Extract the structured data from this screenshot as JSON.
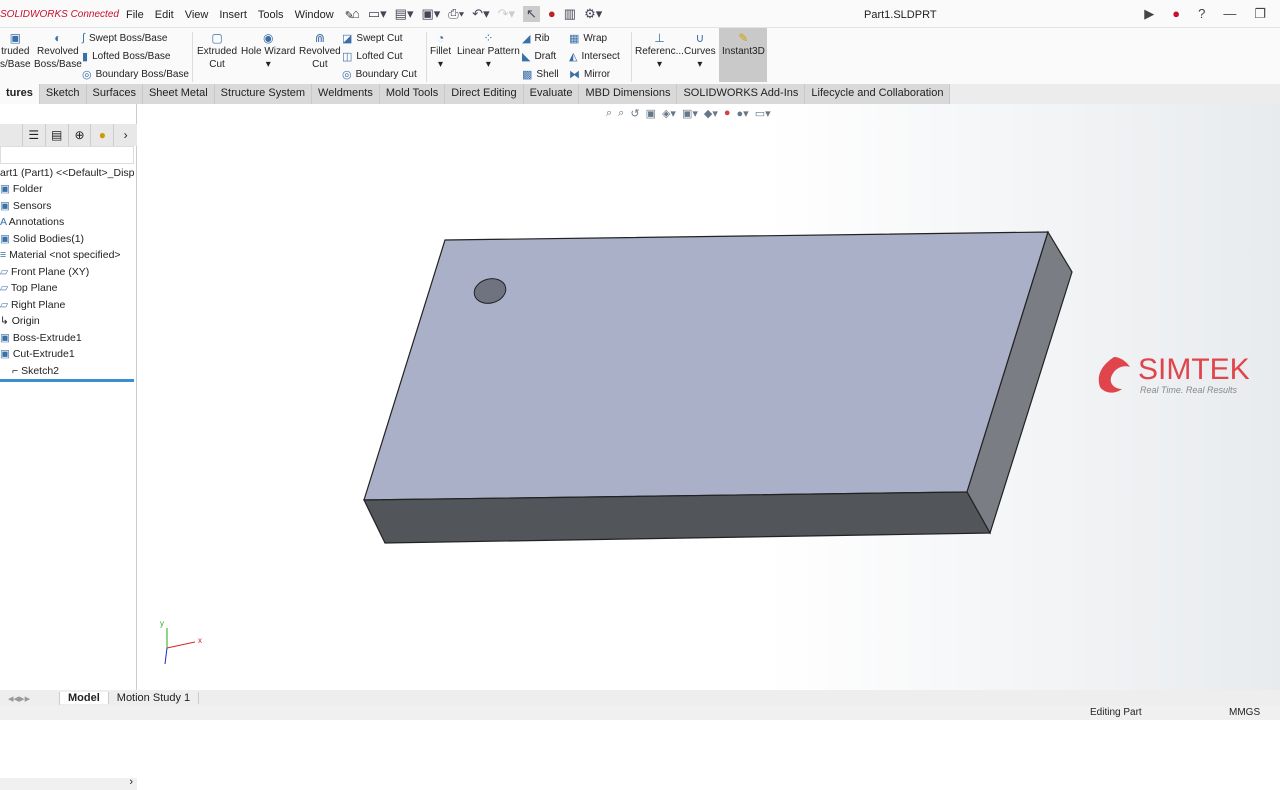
{
  "app": {
    "brand": "SOLIDWORKS Connected",
    "document_title": "Part1.SLDPRT"
  },
  "menu": [
    "File",
    "Edit",
    "View",
    "Insert",
    "Tools",
    "Window"
  ],
  "ribbon": {
    "large": [
      {
        "label": "Extruded Boss/Base",
        "short1": "truded",
        "short2": "s/Base"
      },
      {
        "label1": "Revolved",
        "label2": "Boss/Base"
      },
      {
        "label1": "Extruded",
        "label2": "Cut"
      },
      {
        "label1": "Hole Wizard",
        "label2": ""
      },
      {
        "label1": "Revolved",
        "label2": "Cut"
      },
      {
        "label1": "Fillet",
        "label2": ""
      },
      {
        "label1": "Linear Pattern",
        "label2": ""
      },
      {
        "label1": "Referenc...",
        "label2": ""
      },
      {
        "label1": "Curves",
        "label2": ""
      },
      {
        "label1": "Instant3D",
        "label2": ""
      }
    ],
    "small": [
      "Swept Boss/Base",
      "Lofted Boss/Base",
      "Boundary Boss/Base",
      "Swept Cut",
      "Lofted Cut",
      "Boundary Cut",
      "Rib",
      "Draft",
      "Shell",
      "Wrap",
      "Intersect",
      "Mirror"
    ]
  },
  "tabs": [
    "tures",
    "Sketch",
    "Surfaces",
    "Sheet Metal",
    "Structure System",
    "Weldments",
    "Mold Tools",
    "Direct Editing",
    "Evaluate",
    "MBD Dimensions",
    "SOLIDWORKS Add-Ins",
    "Lifecycle and Collaboration"
  ],
  "tree": [
    "art1 (Part1) <<Default>_Disp",
    "Folder",
    "Sensors",
    "Annotations",
    "Solid Bodies(1)",
    "Material <not specified>",
    "Front Plane (XY)",
    "Top Plane",
    "Right Plane",
    "Origin",
    "Boss-Extrude1",
    "Cut-Extrude1",
    "Sketch2"
  ],
  "bottom_tabs": [
    "Model",
    "Motion Study 1"
  ],
  "status": {
    "mode": "Editing Part",
    "units": "MMGS"
  },
  "logo": {
    "name": "SIMTEK",
    "tagline": "Real Time. Real Results"
  },
  "triad": {
    "x": "x",
    "y": "y"
  },
  "colors": {
    "brand": "#c8102e",
    "top_face": "#aab0c8",
    "side_face": "#7a7d84",
    "front_face": "#52555a",
    "logo": "#e0454c"
  }
}
